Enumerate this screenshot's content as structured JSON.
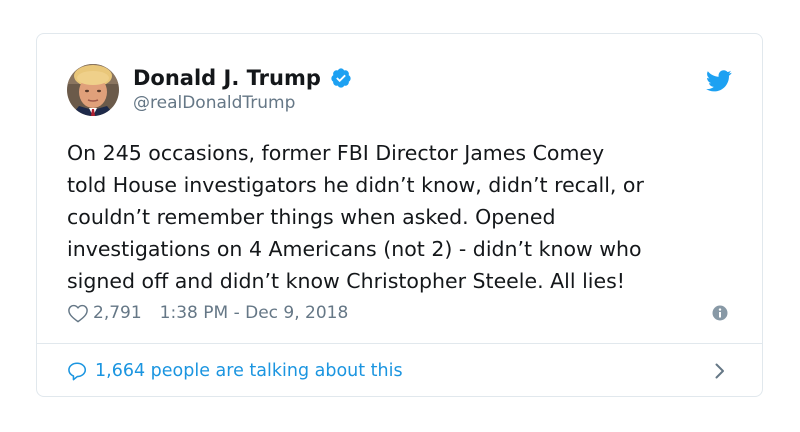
{
  "author": {
    "display_name": "Donald J. Trump",
    "handle": "@realDonaldTrump",
    "verified": true,
    "avatar_icon": "profile-photo"
  },
  "tweet": {
    "text": "On 245  occasions, former FBI Director James Comey\ntold House investigators he didn’t know, didn’t recall, or\ncouldn’t remember things when asked. Opened\ninvestigations on 4 Americans (not 2) - didn’t know who\nsigned off and didn’t know Christopher Steele. All lies!",
    "likes": "2,791",
    "timestamp": "1:38 PM - Dec 9, 2018"
  },
  "footer": {
    "talking_text": "1,664 people are talking about this"
  },
  "icons": {
    "brand": "twitter-bird-icon",
    "verified": "verified-badge-icon",
    "like": "heart-icon",
    "info": "info-icon",
    "reply": "speech-bubble-icon",
    "chevron": "chevron-right-icon"
  },
  "colors": {
    "brand_blue": "#1da1f2",
    "link_blue": "#1b95e0",
    "text": "#14171a",
    "secondary": "#657786",
    "border": "#e1e8ed"
  }
}
